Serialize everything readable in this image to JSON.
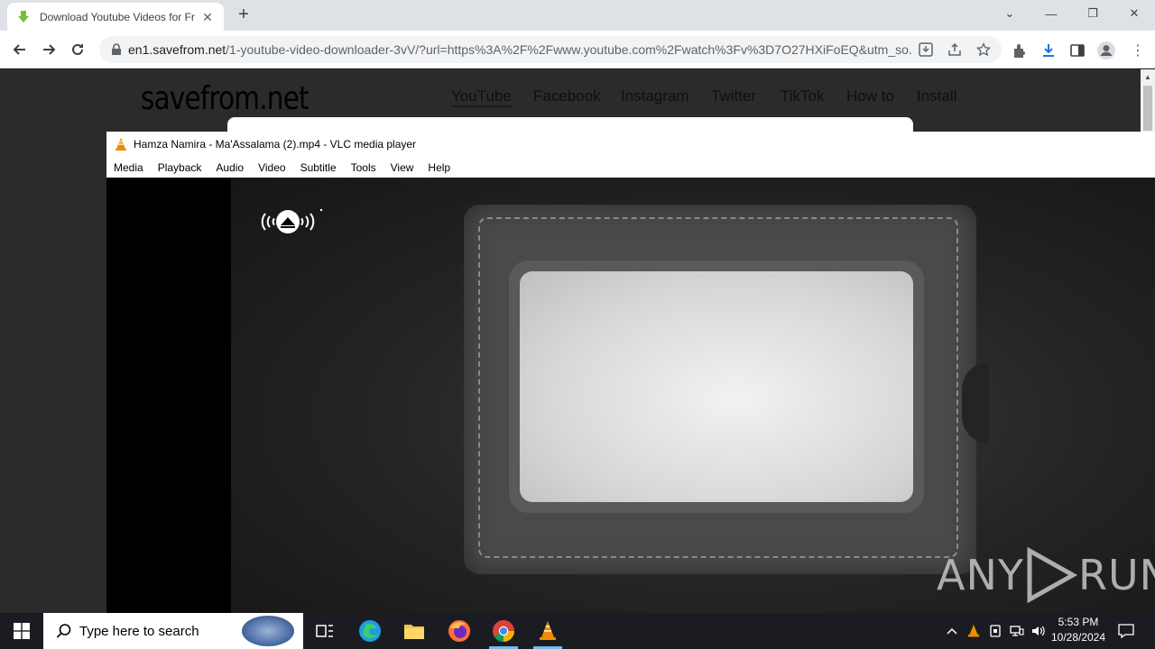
{
  "browser": {
    "tab_title": "Download Youtube Videos for Fr",
    "new_tab_symbol": "+",
    "url_host": "en1.savefrom.net",
    "url_rest": "/1-youtube-video-downloader-3vV/?url=https%3A%2F%2Fwww.youtube.com%2Fwatch%3Fv%3D7O27HXiFoEQ&utm_so..."
  },
  "site": {
    "logo": "savefrom.net",
    "nav": [
      "YouTube",
      "Facebook",
      "Instagram",
      "Twitter",
      "TikTok",
      "How to",
      "Install"
    ]
  },
  "vlc": {
    "title": "Hamza Namira - Ma'Assalama  (2).mp4 - VLC media player",
    "menu": [
      "Media",
      "Playback",
      "Audio",
      "Video",
      "Subtitle",
      "Tools",
      "View",
      "Help"
    ]
  },
  "watermark": {
    "left": "ANY",
    "right": "RUN"
  },
  "taskbar": {
    "search_placeholder": "Type here to search",
    "time": "5:53 PM",
    "date": "10/28/2024"
  },
  "colors": {
    "chrome_tabstrip": "#dee1e6",
    "taskbar": "#1b1c22",
    "page_dim": "#2b2b2b",
    "vlc_orange": "#f08a00"
  },
  "icons": [
    "download-favicon-icon",
    "back-icon",
    "forward-icon",
    "reload-icon",
    "lock-icon",
    "download-page-icon",
    "share-icon",
    "star-icon",
    "extensions-icon",
    "downloads-icon",
    "side-panel-icon",
    "profile-icon",
    "vlc-cone-icon",
    "windows-start-icon",
    "search-icon",
    "task-view-icon",
    "edge-icon",
    "file-explorer-icon",
    "firefox-icon",
    "chrome-icon",
    "vlc-taskbar-icon"
  ]
}
